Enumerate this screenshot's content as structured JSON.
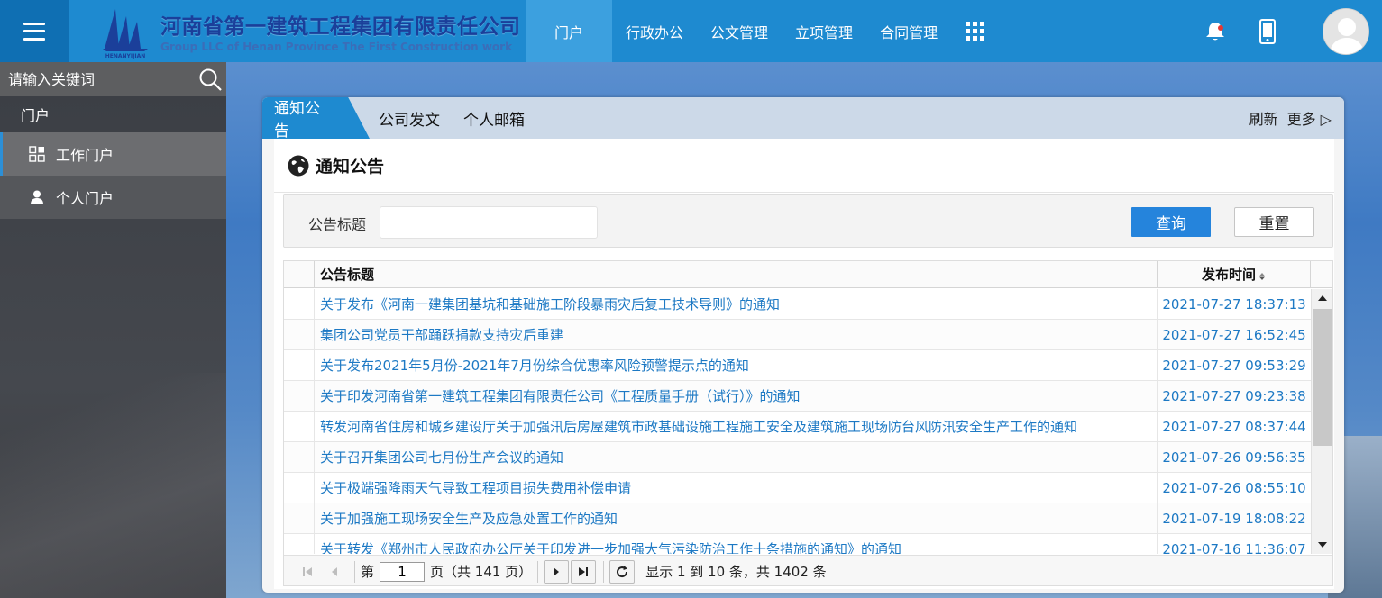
{
  "header": {
    "company_name": "河南省第一建筑工程集团有限责任公司",
    "company_en": "Group LLC of Henan Province The First Construction work",
    "logo_caption": "HENANYIJIAN",
    "nav": [
      {
        "label": "门户",
        "active": true
      },
      {
        "label": "行政办公",
        "active": false
      },
      {
        "label": "公文管理",
        "active": false
      },
      {
        "label": "立项管理",
        "active": false
      },
      {
        "label": "合同管理",
        "active": false
      }
    ],
    "icons": [
      "menu-icon",
      "apps-grid-icon",
      "bell-icon",
      "mobile-icon",
      "avatar"
    ],
    "colors": {
      "topbar": "#1e8ad0",
      "active_nav": "#3ca0df",
      "menu_btn": "#0f6fb3"
    }
  },
  "sidebar": {
    "search_placeholder": "请输入关键词",
    "section_label": "门户",
    "items": [
      {
        "label": "工作门户",
        "icon": "grid-icon",
        "active": true
      },
      {
        "label": "个人门户",
        "icon": "user-icon",
        "active": false
      }
    ]
  },
  "panel": {
    "tabs": [
      {
        "label": "通知公告",
        "active": true
      },
      {
        "label": "公司发文",
        "active": false
      },
      {
        "label": "个人邮箱",
        "active": false
      }
    ],
    "actions": {
      "refresh": "刷新",
      "more": "更多 ▷"
    },
    "title": "通知公告",
    "filter": {
      "label": "公告标题",
      "value": "",
      "query_button": "查询",
      "reset_button": "重置"
    },
    "table": {
      "columns": [
        "公告标题",
        "发布时间"
      ],
      "rows": [
        {
          "title": "关于发布《河南一建集团基坑和基础施工阶段暴雨灾后复工技术导则》的通知",
          "time": "2021-07-27 18:37:13"
        },
        {
          "title": "集团公司党员干部踊跃捐款支持灾后重建",
          "time": "2021-07-27 16:52:45"
        },
        {
          "title": "关于发布2021年5月份-2021年7月份综合优惠率风险预警提示点的通知",
          "time": "2021-07-27 09:53:29"
        },
        {
          "title": "关于印发河南省第一建筑工程集团有限责任公司《工程质量手册（试行）》的通知",
          "time": "2021-07-27 09:23:38"
        },
        {
          "title": "转发河南省住房和城乡建设厅关于加强汛后房屋建筑市政基础设施工程施工安全及建筑施工现场防台风防汛安全生产工作的通知",
          "time": "2021-07-27 08:37:44"
        },
        {
          "title": "关于召开集团公司七月份生产会议的通知",
          "time": "2021-07-26 09:56:35"
        },
        {
          "title": "关于极端强降雨天气导致工程项目损失费用补偿申请",
          "time": "2021-07-26 08:55:10"
        },
        {
          "title": "关于加强施工现场安全生产及应急处置工作的通知",
          "time": "2021-07-19 18:08:22"
        },
        {
          "title": "关于转发《郑州市人民政府办公厅关于印发进一步加强大气污染防治工作十条措施的通知》的通知",
          "time": "2021-07-16 11:36:07"
        }
      ]
    },
    "pager": {
      "page_prefix": "第",
      "current_page": "1",
      "page_suffix": "页（共 141 页）",
      "summary": "显示 1 到 10 条，共 1402 条"
    }
  }
}
